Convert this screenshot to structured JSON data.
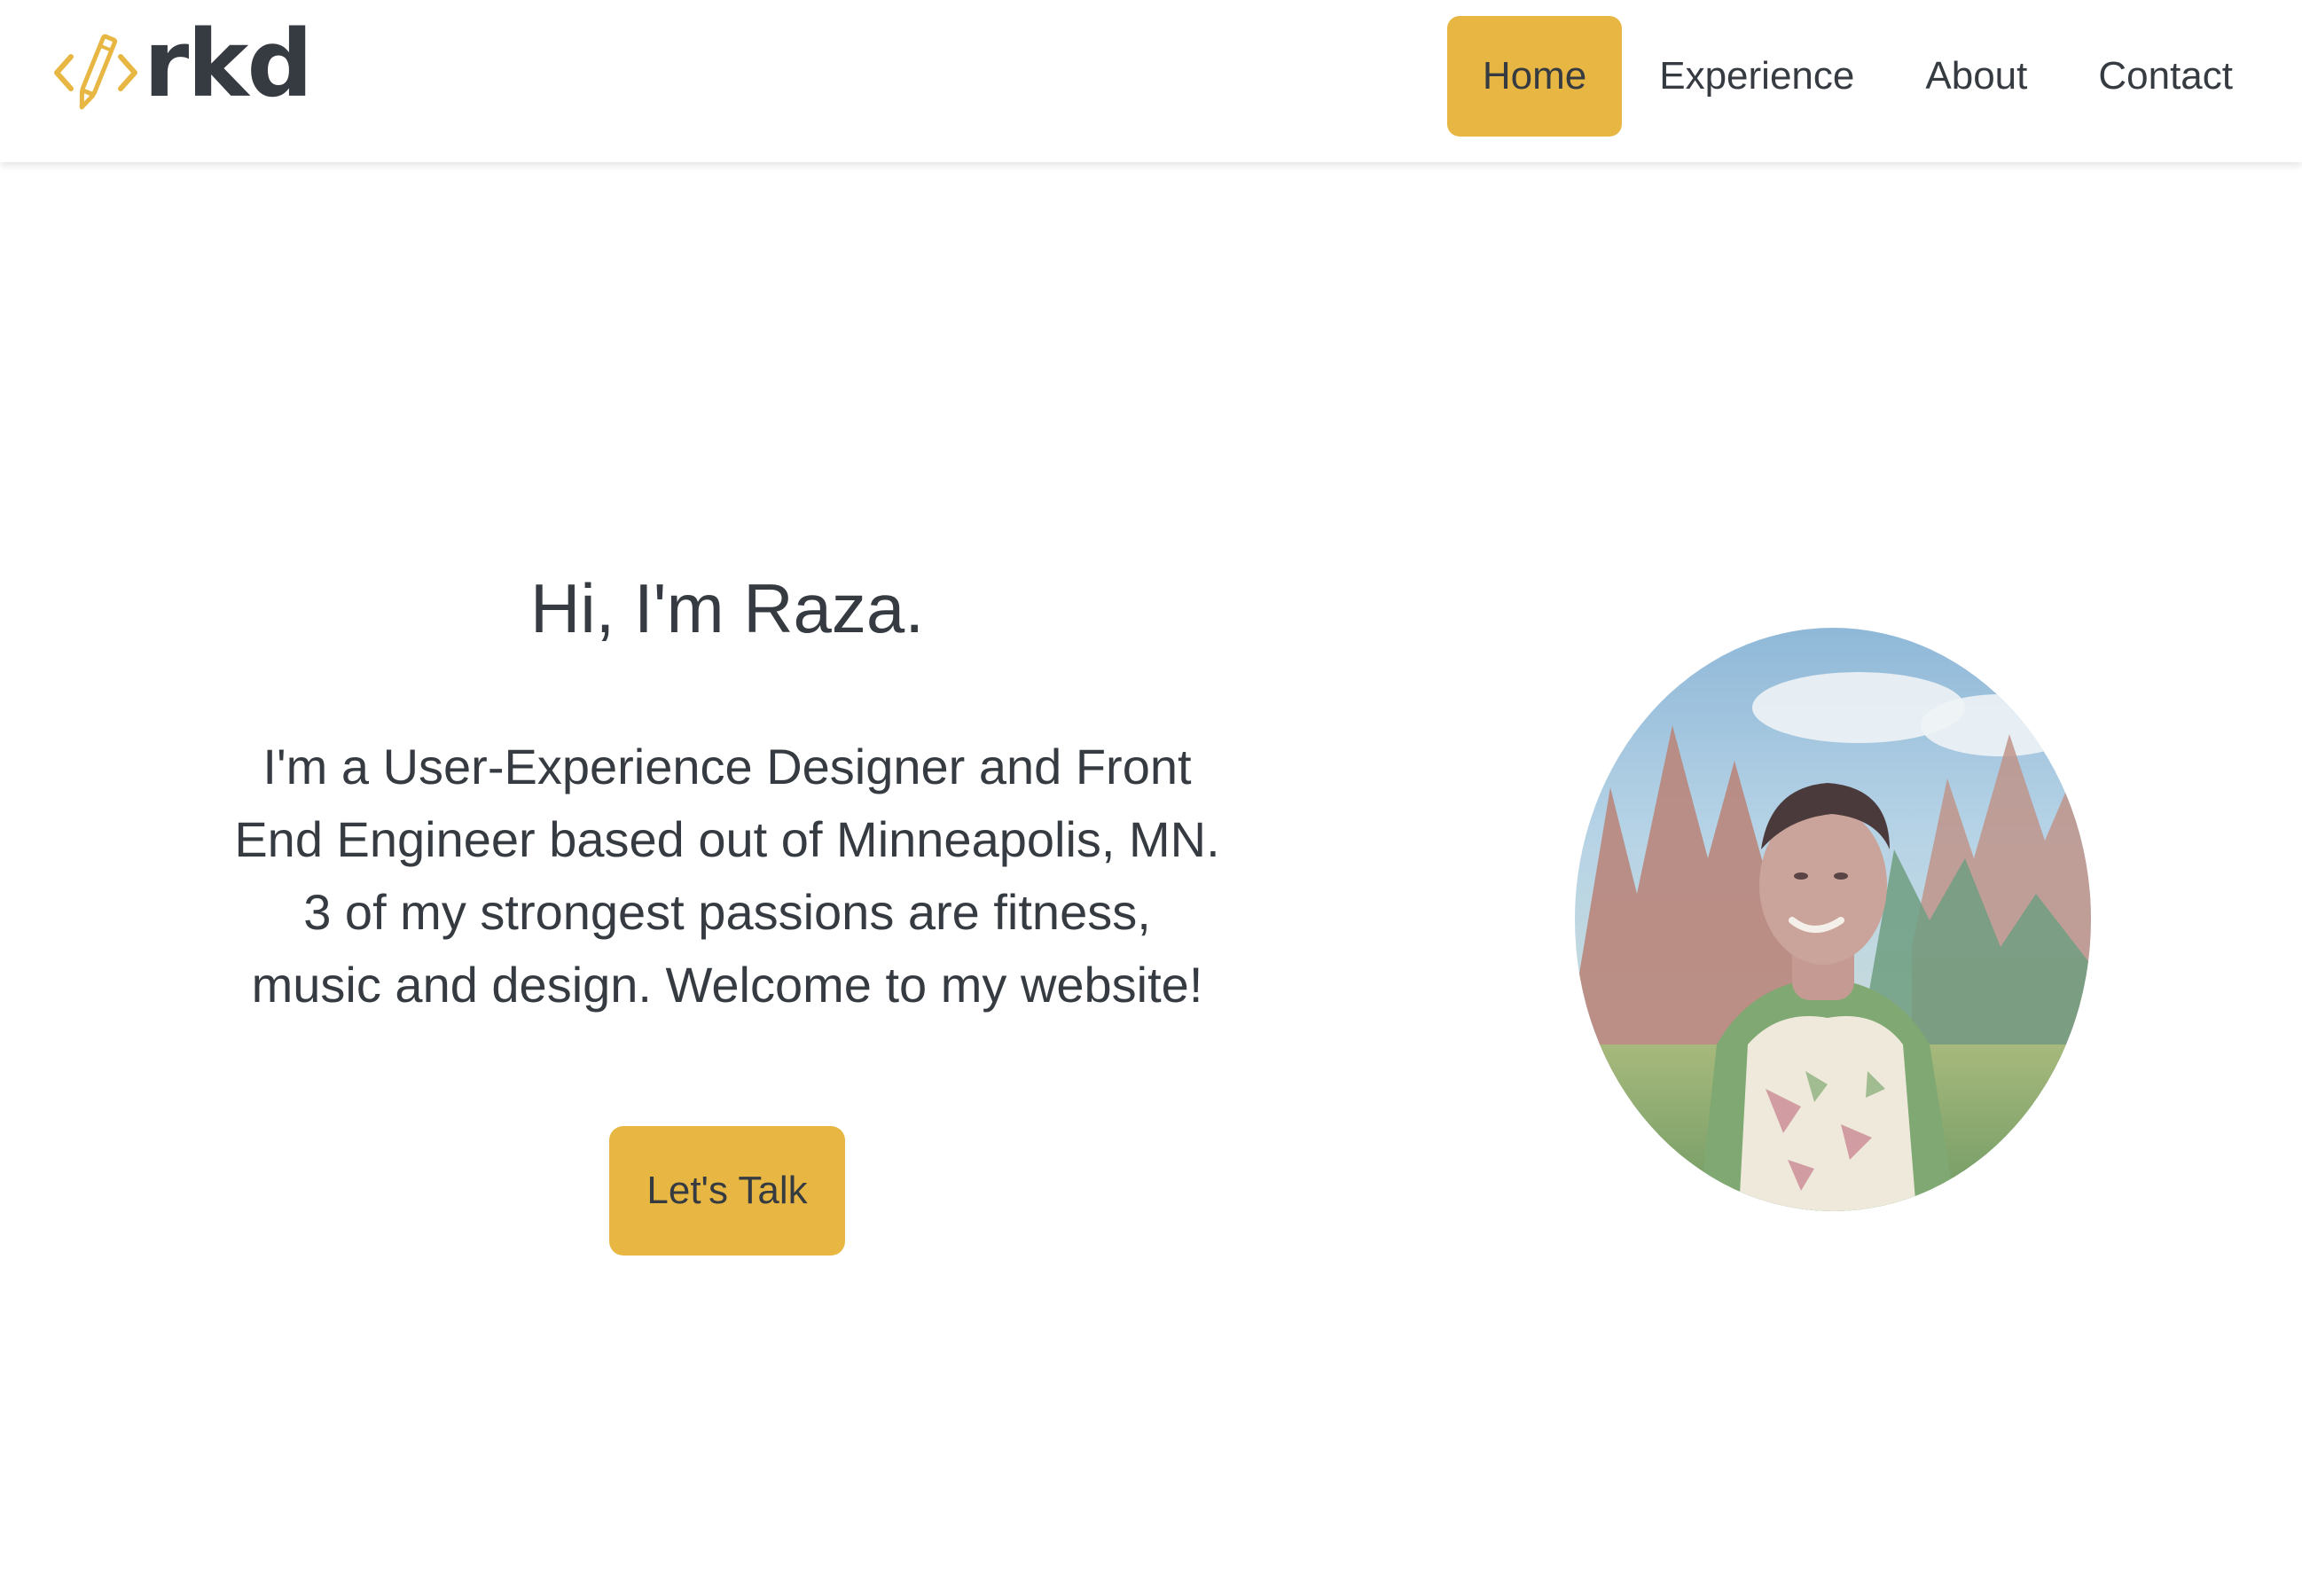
{
  "logo": {
    "text": "rkd",
    "icon": "code-pencil-icon",
    "accent_color": "#e8b743"
  },
  "nav": {
    "items": [
      {
        "label": "Home",
        "active": true
      },
      {
        "label": "Experience",
        "active": false
      },
      {
        "label": "About",
        "active": false
      },
      {
        "label": "Contact",
        "active": false
      }
    ]
  },
  "hero": {
    "title": "Hi, I'm Raza.",
    "description_lines": [
      "I'm a User-Experience Designer and Front",
      "End Engineer based out of Minneapolis, MN.",
      "3 of my strongest passions are fitness,",
      "music and design. Welcome to my website!"
    ],
    "cta_label": "Let's Talk"
  },
  "colors": {
    "accent": "#e8b743",
    "text": "#363b42",
    "background": "#ffffff"
  }
}
